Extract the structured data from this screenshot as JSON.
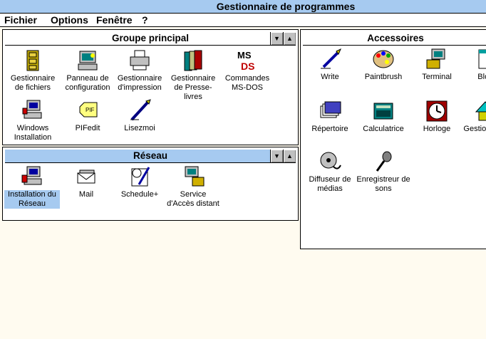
{
  "app": {
    "title": "Gestionnaire de programmes"
  },
  "menu": [
    {
      "label": "Fichier"
    },
    {
      "label": "Options"
    },
    {
      "label": "Fenêtre"
    },
    {
      "label": "?"
    }
  ],
  "groups": {
    "main": {
      "title": "Groupe principal",
      "items": [
        {
          "label": "Gestionnaire de fichiers",
          "icon": "file-cabinet-icon"
        },
        {
          "label": "Panneau de configuration",
          "icon": "control-panel-icon"
        },
        {
          "label": "Gestionnaire d'impression",
          "icon": "printer-icon"
        },
        {
          "label": "Gestionnaire de Presse-livres",
          "icon": "clipbook-icon"
        },
        {
          "label": "Commandes MS-DOS",
          "icon": "msdos-icon"
        },
        {
          "label": "Windows Installation",
          "icon": "setup-computer-icon"
        },
        {
          "label": "PIFedit",
          "icon": "pif-tag-icon"
        },
        {
          "label": "Lisezmoi",
          "icon": "readme-pen-icon"
        }
      ]
    },
    "network": {
      "title": "Réseau",
      "items": [
        {
          "label": "Installation du Réseau",
          "icon": "network-setup-icon",
          "selected": true
        },
        {
          "label": "Mail",
          "icon": "mail-icon"
        },
        {
          "label": "Schedule+",
          "icon": "schedule-icon"
        },
        {
          "label": "Service d'Accès distant",
          "icon": "remote-access-icon"
        }
      ]
    },
    "accessories": {
      "title": "Accessoires",
      "items": [
        {
          "label": "Write",
          "icon": "write-pen-icon"
        },
        {
          "label": "Paintbrush",
          "icon": "palette-icon"
        },
        {
          "label": "Terminal",
          "icon": "terminal-phone-icon"
        },
        {
          "label": "Bloc",
          "icon": "notepad-icon"
        },
        {
          "label": "Répertoire",
          "icon": "cardfile-icon"
        },
        {
          "label": "Calculatrice",
          "icon": "calculator-icon"
        },
        {
          "label": "Horloge",
          "icon": "clock-icon"
        },
        {
          "label": "Gestion de li",
          "icon": "object-packager-icon"
        },
        {
          "label": "Diffuseur de médias",
          "icon": "media-reel-icon"
        },
        {
          "label": "Enregistreur de sons",
          "icon": "microphone-icon"
        }
      ]
    }
  },
  "colors": {
    "active_title": "#a6caf0",
    "desktop": "#fffbf0",
    "selection": "#a6caf0"
  }
}
